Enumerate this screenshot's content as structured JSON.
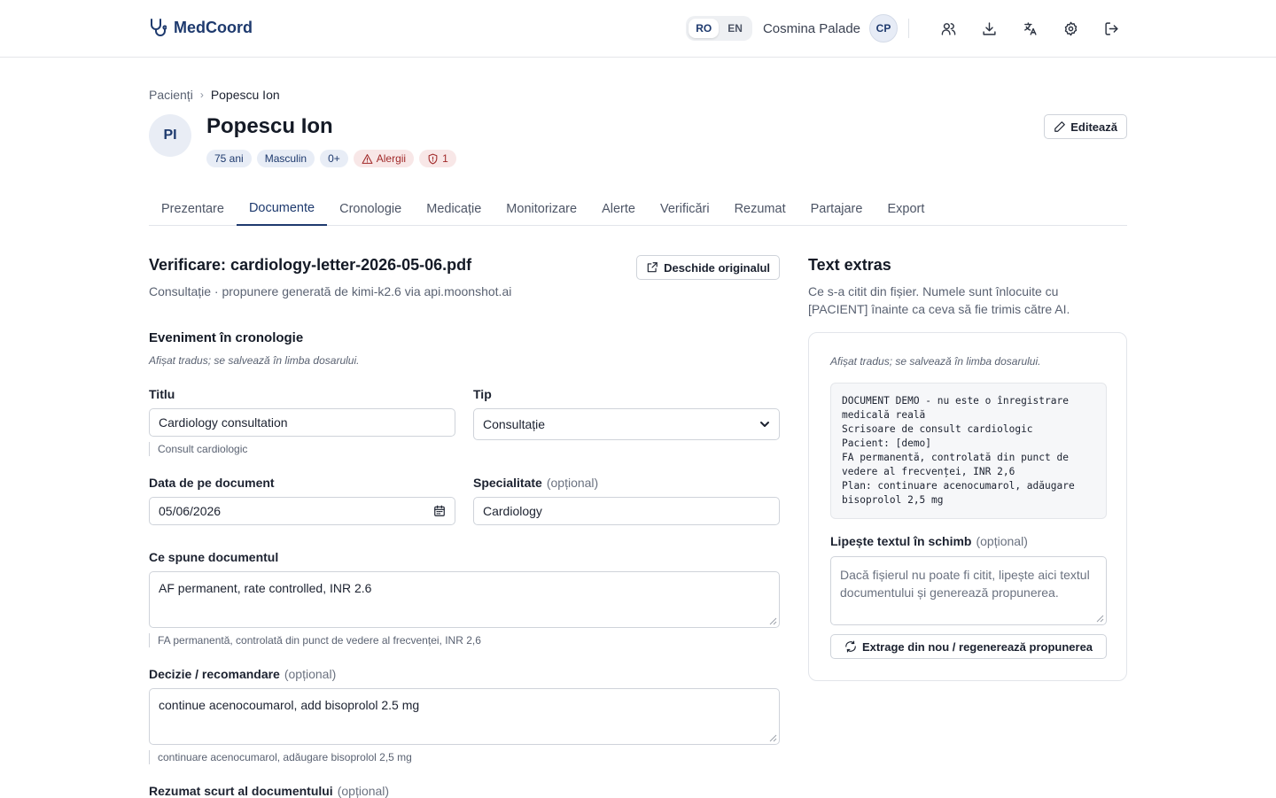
{
  "app": {
    "brand": "MedCoord"
  },
  "header": {
    "languages": [
      "RO",
      "EN"
    ],
    "active_language": "RO",
    "user_name": "Cosmina Palade",
    "user_initials": "CP",
    "icons": [
      "users-icon",
      "download-icon",
      "translate-icon",
      "settings-icon",
      "logout-icon"
    ]
  },
  "breadcrumb": {
    "root": "Pacienți",
    "current": "Popescu Ion"
  },
  "patient": {
    "initials": "PI",
    "name": "Popescu Ion",
    "badges": {
      "age": "75 ani",
      "sex": "Masculin",
      "blood": "0+",
      "allergies": "Alergii",
      "alerts": "1"
    },
    "edit_label": "Editează"
  },
  "tabs": [
    "Prezentare",
    "Documente",
    "Cronologie",
    "Medicație",
    "Monitorizare",
    "Alerte",
    "Verificări",
    "Rezumat",
    "Partajare",
    "Export"
  ],
  "active_tab": "Documente",
  "review": {
    "title": "Verificare: cardiology-letter-2026-05-06.pdf",
    "open_original": "Deschide originalul",
    "subtitle": "Consultație · propunere generată de kimi-k2.6 via api.moonshot.ai",
    "section_title": "Eveniment în cronologie",
    "hint": "Afișat tradus; se salvează în limba dosarului.",
    "optional": "(opțional)",
    "fields": {
      "title_label": "Titlu",
      "title_value": "Cardiology consultation",
      "title_translation": "Consult cardiologic",
      "type_label": "Tip",
      "type_value": "Consultație",
      "date_label": "Data de pe document",
      "date_value": "05/06/2026",
      "specialty_label": "Specialitate",
      "specialty_value": "Cardiology",
      "says_label": "Ce spune documentul",
      "says_value": "AF permanent, rate controlled, INR 2.6",
      "says_translation": "FA permanentă, controlată din punct de vedere al frecvenței, INR 2,6",
      "decision_label": "Decizie / recomandare",
      "decision_value": "continue acenocoumarol, add bisoprolol 2.5 mg",
      "decision_translation": "continuare acenocumarol, adăugare bisoprolol 2,5 mg",
      "summary_label": "Rezumat scurt al documentului"
    }
  },
  "extracted": {
    "title": "Text extras",
    "description": "Ce s-a citit din fișier. Numele sunt înlocuite cu [PACIENT] înainte ca ceva să fie trimis către AI.",
    "hint": "Afișat tradus; se salvează în limba dosarului.",
    "text": "DOCUMENT DEMO - nu este o înregistrare medicală reală\nScrisoare de consult cardiologic\nPacient: [demo]\nFA permanentă, controlată din punct de vedere al frecvenței, INR 2,6\nPlan: continuare acenocumarol, adăugare bisoprolol 2,5 mg",
    "paste_label": "Lipește textul în schimb",
    "paste_placeholder": "Dacă fișierul nu poate fi citit, lipește aici textul documentului și generează propunerea.",
    "regen_label": "Extrage din nou / regenerează propunerea"
  }
}
